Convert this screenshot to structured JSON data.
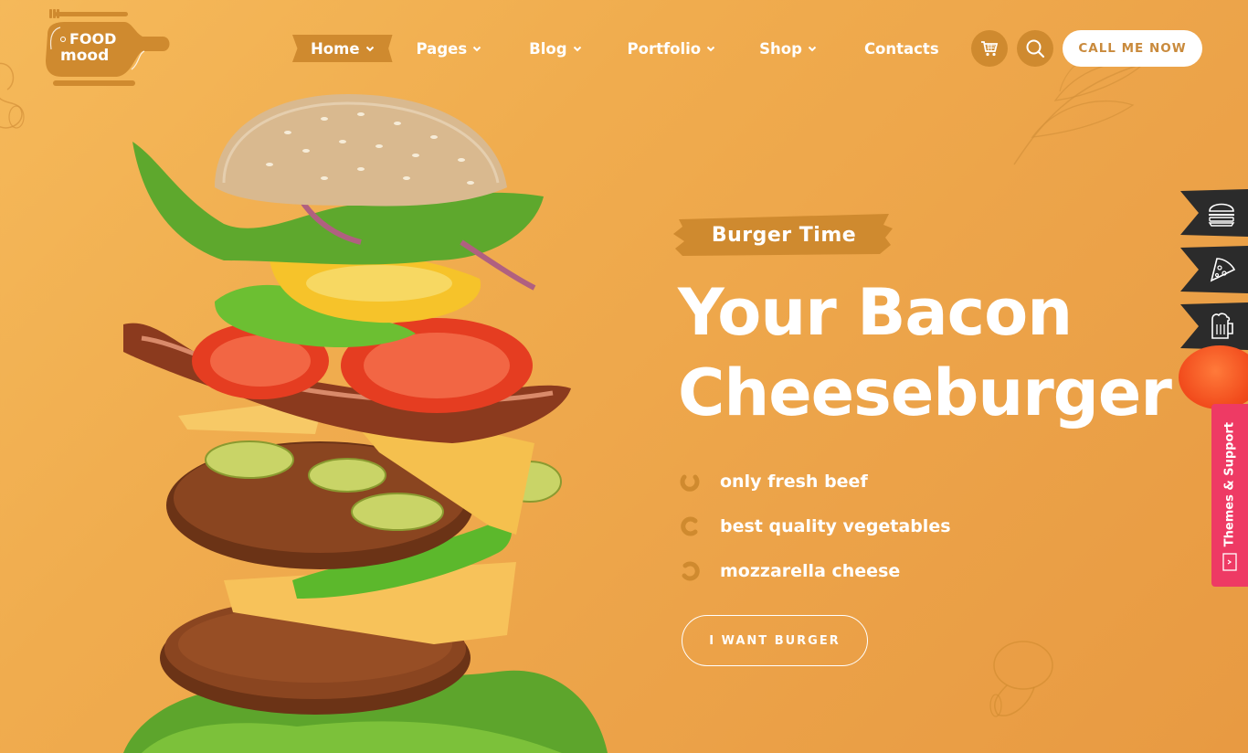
{
  "brand": {
    "logo_line1": "FOOD",
    "logo_line2": "mood",
    "colors": {
      "background": "#f0ac4e",
      "accent": "#cf8a2f",
      "ribbon": "#2b2b2b",
      "support": "#ee3a64",
      "white": "#ffffff"
    }
  },
  "nav": {
    "items": [
      {
        "label": "Home",
        "has_dropdown": true,
        "active": true
      },
      {
        "label": "Pages",
        "has_dropdown": true,
        "active": false
      },
      {
        "label": "Blog",
        "has_dropdown": true,
        "active": false
      },
      {
        "label": "Portfolio",
        "has_dropdown": true,
        "active": false
      },
      {
        "label": "Shop",
        "has_dropdown": true,
        "active": false
      },
      {
        "label": "Contacts",
        "has_dropdown": false,
        "active": false
      }
    ],
    "cart_icon": "cart-icon",
    "search_icon": "search-icon",
    "cta_label": "CALL ME NOW"
  },
  "hero": {
    "tag": "Burger Time",
    "headline_line1": "Your Bacon",
    "headline_line2": "Cheeseburger",
    "features": [
      "only fresh beef",
      "best quality vegetables",
      "mozzarella cheese"
    ],
    "button_label": "I WANT BURGER",
    "image_alt": "flying burger ingredients"
  },
  "side": {
    "ribbons": [
      {
        "icon": "burger-icon"
      },
      {
        "icon": "pizza-icon"
      },
      {
        "icon": "beer-icon"
      }
    ],
    "support_label": "Themes & Support"
  }
}
